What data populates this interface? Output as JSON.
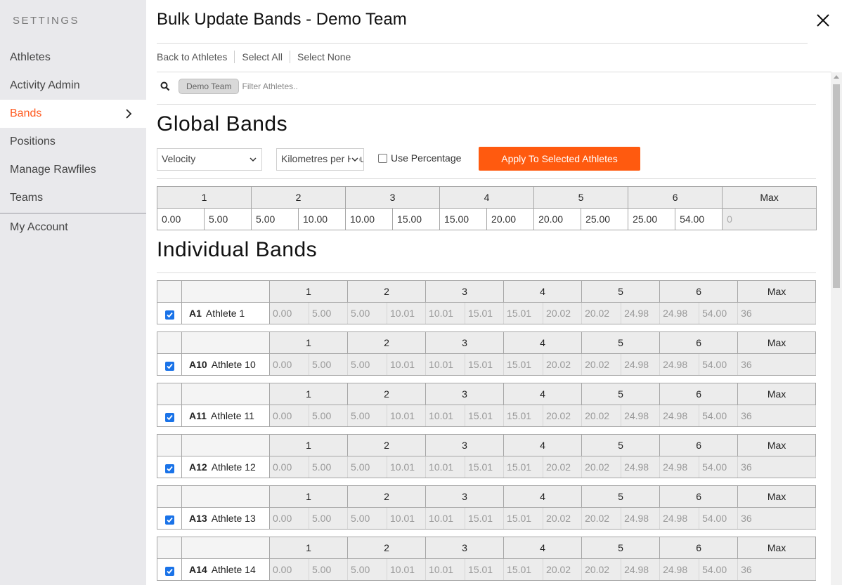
{
  "sidebar": {
    "heading": "SETTINGS",
    "items": [
      {
        "label": "Athletes"
      },
      {
        "label": "Activity Admin"
      },
      {
        "label": "Bands"
      },
      {
        "label": "Positions"
      },
      {
        "label": "Manage Rawfiles"
      },
      {
        "label": "Teams"
      },
      {
        "label": "My Account"
      }
    ],
    "active": "Bands"
  },
  "header": {
    "title": "Bulk Update Bands - Demo Team"
  },
  "toolbar": {
    "back": "Back to Athletes",
    "select_all": "Select All",
    "select_none": "Select None"
  },
  "filter": {
    "team_chip": "Demo Team",
    "placeholder": "Filter Athletes.."
  },
  "global": {
    "title": "Global Bands",
    "metric": "Velocity",
    "unit": "Kilometres per Hour",
    "use_percentage_label": "Use Percentage",
    "use_percentage_checked": false,
    "apply_label": "Apply To Selected Athletes",
    "columns": [
      "1",
      "2",
      "3",
      "4",
      "5",
      "6",
      "Max"
    ],
    "values": [
      "0.00",
      "5.00",
      "5.00",
      "10.00",
      "10.00",
      "15.00",
      "15.00",
      "20.00",
      "20.00",
      "25.00",
      "25.00",
      "54.00"
    ],
    "max_placeholder": "0"
  },
  "individual": {
    "title": "Individual Bands",
    "columns": [
      "1",
      "2",
      "3",
      "4",
      "5",
      "6",
      "Max"
    ],
    "athletes": [
      {
        "code": "A1",
        "name": "Athlete 1",
        "checked": true,
        "values": [
          "0.00",
          "5.00",
          "5.00",
          "10.01",
          "10.01",
          "15.01",
          "15.01",
          "20.02",
          "20.02",
          "24.98",
          "24.98",
          "54.00"
        ],
        "max": "36"
      },
      {
        "code": "A10",
        "name": "Athlete 10",
        "checked": true,
        "values": [
          "0.00",
          "5.00",
          "5.00",
          "10.01",
          "10.01",
          "15.01",
          "15.01",
          "20.02",
          "20.02",
          "24.98",
          "24.98",
          "54.00"
        ],
        "max": "36"
      },
      {
        "code": "A11",
        "name": "Athlete 11",
        "checked": true,
        "values": [
          "0.00",
          "5.00",
          "5.00",
          "10.01",
          "10.01",
          "15.01",
          "15.01",
          "20.02",
          "20.02",
          "24.98",
          "24.98",
          "54.00"
        ],
        "max": "36"
      },
      {
        "code": "A12",
        "name": "Athlete 12",
        "checked": true,
        "values": [
          "0.00",
          "5.00",
          "5.00",
          "10.01",
          "10.01",
          "15.01",
          "15.01",
          "20.02",
          "20.02",
          "24.98",
          "24.98",
          "54.00"
        ],
        "max": "36"
      },
      {
        "code": "A13",
        "name": "Athlete 13",
        "checked": true,
        "values": [
          "0.00",
          "5.00",
          "5.00",
          "10.01",
          "10.01",
          "15.01",
          "15.01",
          "20.02",
          "20.02",
          "24.98",
          "24.98",
          "54.00"
        ],
        "max": "36"
      },
      {
        "code": "A14",
        "name": "Athlete 14",
        "checked": true,
        "values": [
          "0.00",
          "5.00",
          "5.00",
          "10.01",
          "10.01",
          "15.01",
          "15.01",
          "20.02",
          "20.02",
          "24.98",
          "24.98",
          "54.00"
        ],
        "max": "36"
      }
    ]
  },
  "colors": {
    "accent": "#ff5a1f",
    "button": "#ff5a0f",
    "checkbox": "#1a73e8"
  }
}
